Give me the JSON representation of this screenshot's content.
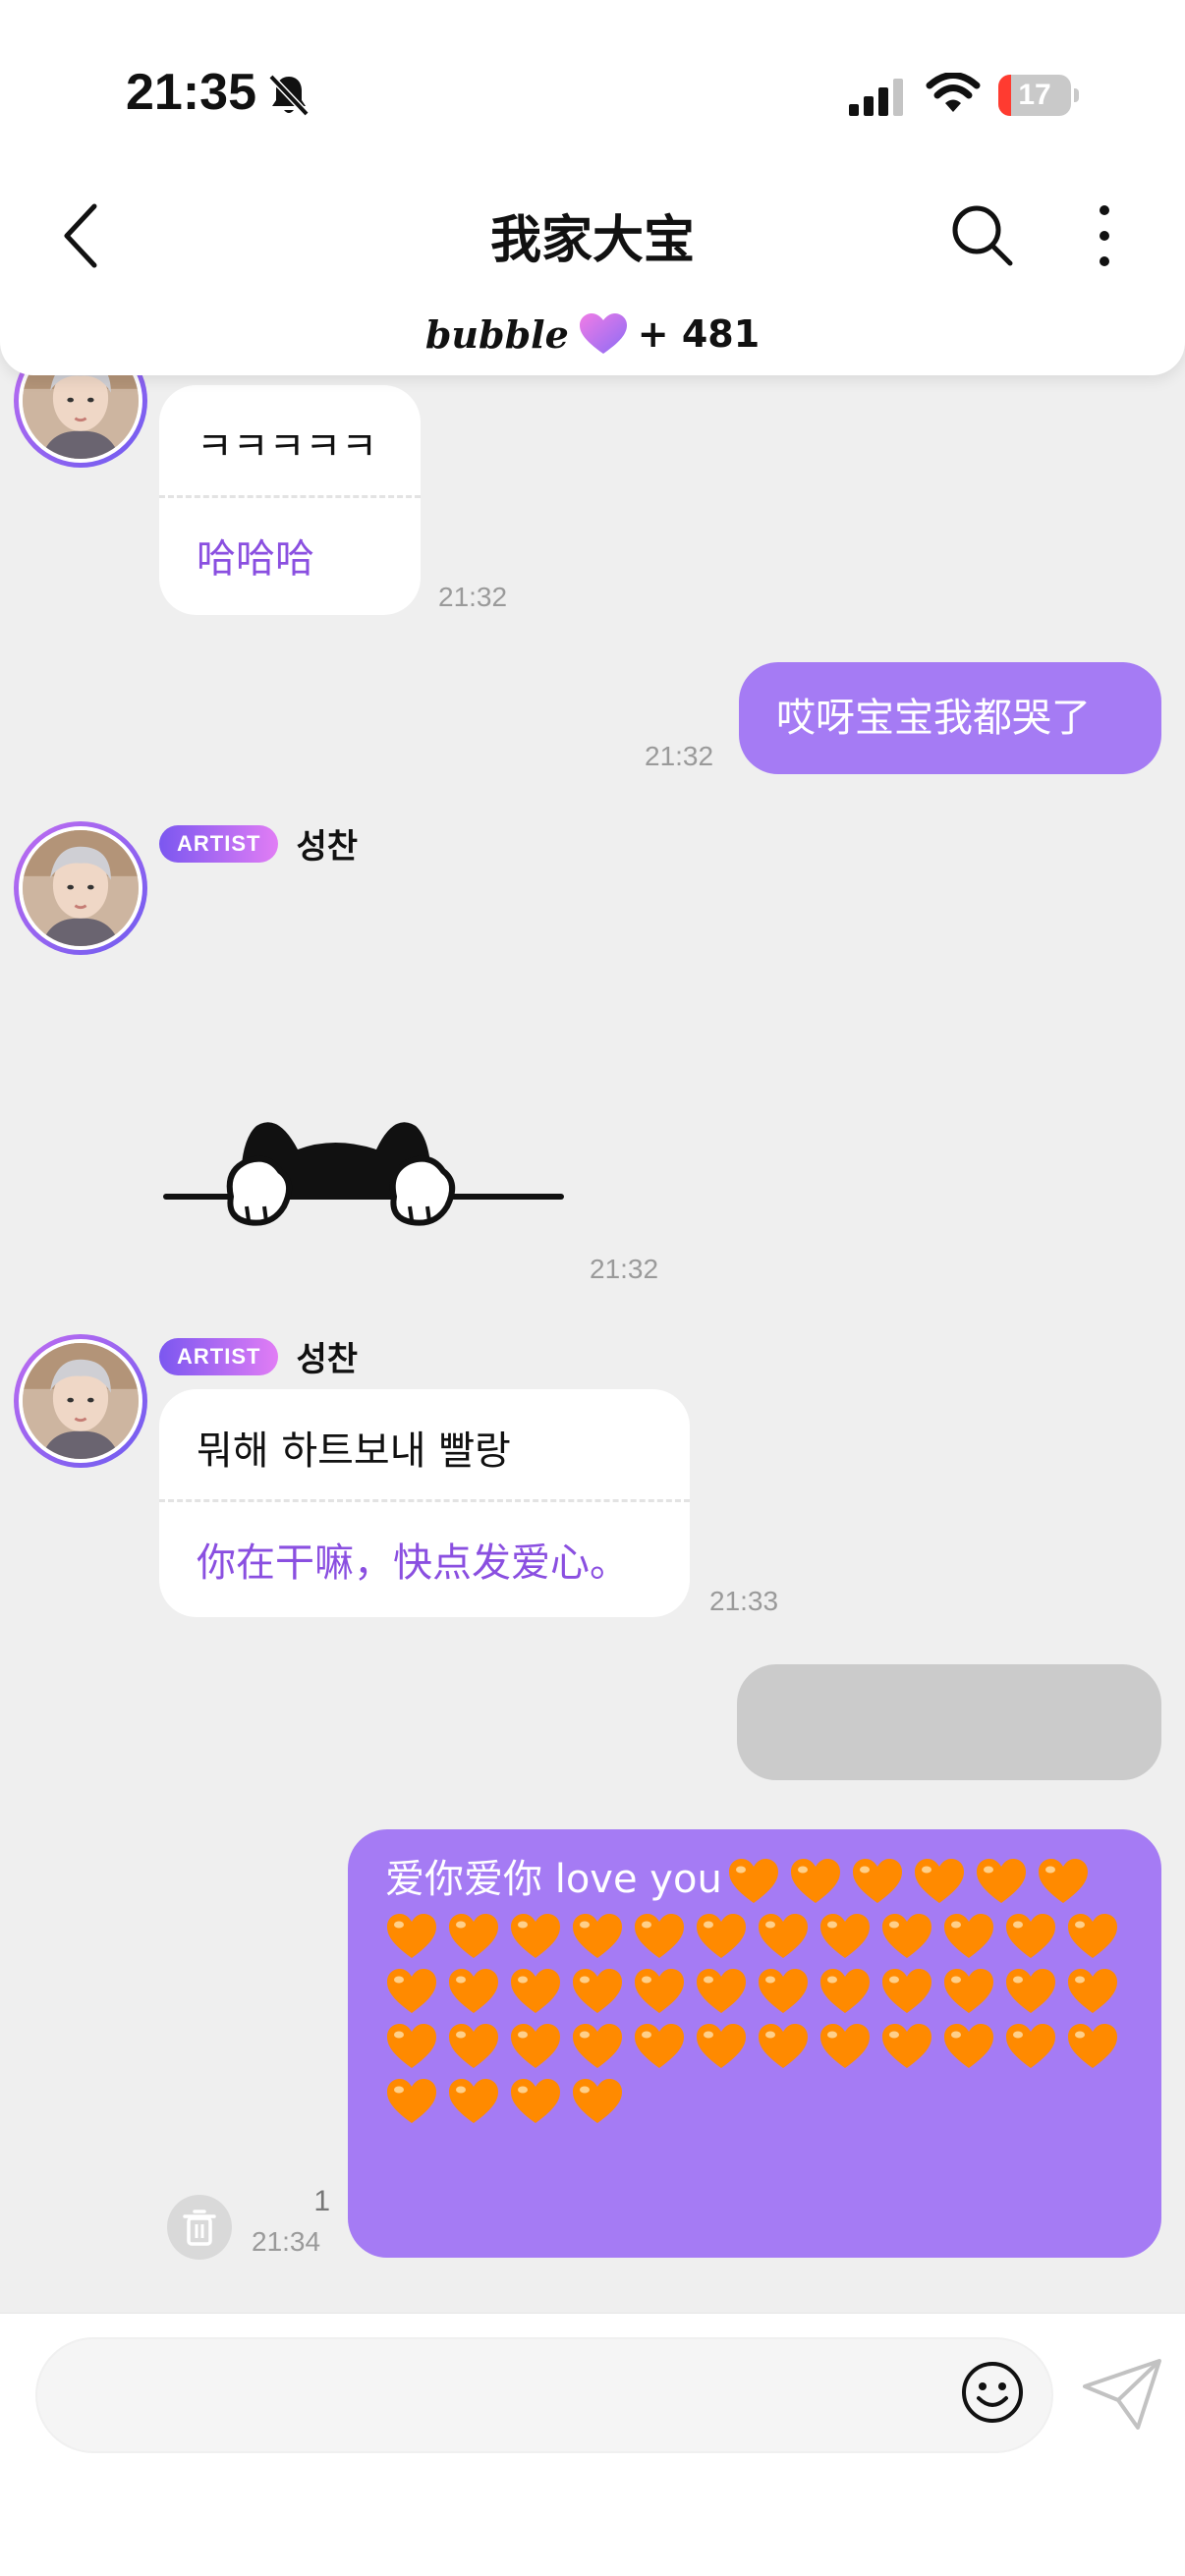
{
  "status_bar": {
    "time": "21:35",
    "battery": "17",
    "battery_level": 0.17,
    "icons": [
      "bell-muted-icon",
      "signal-icon",
      "wifi-icon",
      "battery-icon"
    ]
  },
  "header": {
    "title": "我家大宝",
    "bubble_logo": "bubble",
    "bubble_count": "+ 481",
    "icons": [
      "back-arrow-icon",
      "search-icon",
      "more-vertical-icon",
      "heart-gradient-icon"
    ]
  },
  "messages": {
    "m1": {
      "original": "ㅋㅋㅋㅋㅋ",
      "translation": "哈哈哈",
      "time": "21:32"
    },
    "m2": {
      "text": "哎呀宝宝我都哭了",
      "time": "21:32"
    },
    "m3": {
      "badge": "ARTIST",
      "name": "성찬",
      "sticker": "peeking-cat-sticker",
      "time": "21:32"
    },
    "m4": {
      "badge": "ARTIST",
      "name": "성찬",
      "original": "뭐해 하트보내 빨랑",
      "translation": "你在干嘛，快点发爱心。",
      "time": "21:33"
    },
    "m6": {
      "text": "爱你爱你 love you",
      "heart_count": 46,
      "heart_emoji": "orange-heart",
      "time": "21:34",
      "read_count": "1"
    }
  },
  "input": {
    "placeholder": "",
    "value": ""
  },
  "colors": {
    "accent": "#a57bf4",
    "translation": "#8a4fe0",
    "background": "#efefef",
    "heart": "#ff8a00"
  }
}
